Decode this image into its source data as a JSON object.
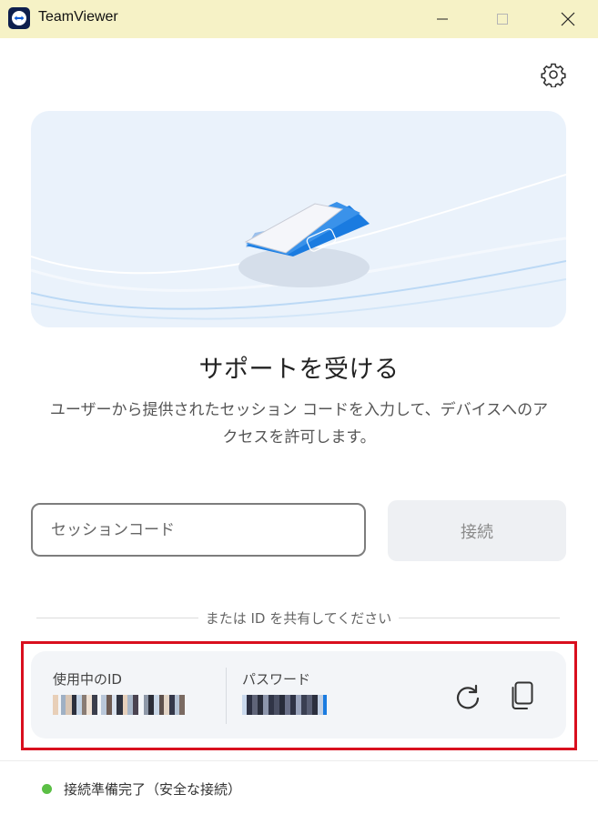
{
  "window": {
    "title": "TeamViewer",
    "minimize_glyph": "—",
    "maximize_glyph": "☐",
    "close_glyph": "✕"
  },
  "icons": {
    "app": "teamviewer-logo",
    "settings": "gear-icon",
    "refresh": "refresh-icon",
    "copy": "copy-icon"
  },
  "main": {
    "heading": "サポートを受ける",
    "description": "ユーザーから提供されたセッション コードを入力して、デバイスへのアクセスを許可します。"
  },
  "session": {
    "placeholder": "セッションコード",
    "value": "",
    "connect_label": "接続"
  },
  "divider": {
    "text": "または ID を共有してください"
  },
  "id_panel": {
    "id_label": "使用中のID",
    "password_label": "パスワード"
  },
  "status": {
    "text": "接続準備完了（安全な接続）",
    "color": "#5bbf45"
  },
  "colors": {
    "titlebar": "#f6f2c6",
    "accent": "#1a7be0",
    "highlight_frame": "#d90f1e"
  }
}
